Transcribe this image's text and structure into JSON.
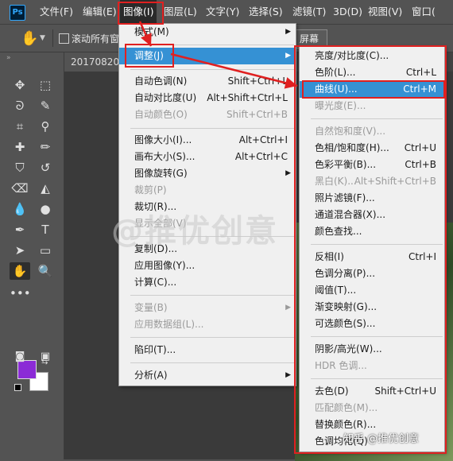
{
  "menubar": {
    "logo": "Ps",
    "items": [
      "文件(F)",
      "编辑(E)",
      "图像(I)",
      "图层(L)",
      "文字(Y)",
      "选择(S)",
      "滤镜(T)",
      "3D(D)",
      "视图(V)",
      "窗口("
    ],
    "active": "图像(I)"
  },
  "optbar": {
    "scroll_all_windows": "滚动所有窗",
    "fill_screen": "屏幕"
  },
  "document": {
    "tab": "20170820_"
  },
  "image_menu": {
    "items": [
      {
        "label": "模式(M)",
        "shortcut": "",
        "submenu": true,
        "disabled": false
      },
      {
        "label": "调整(J)",
        "shortcut": "",
        "submenu": true,
        "disabled": false,
        "highlight": true
      },
      {
        "label": "自动色调(N)",
        "shortcut": "Shift+Ctrl+L",
        "disabled": false
      },
      {
        "label": "自动对比度(U)",
        "shortcut": "Alt+Shift+Ctrl+L",
        "disabled": false
      },
      {
        "label": "自动颜色(O)",
        "shortcut": "Shift+Ctrl+B",
        "disabled": true
      },
      {
        "label": "图像大小(I)...",
        "shortcut": "Alt+Ctrl+I",
        "disabled": false
      },
      {
        "label": "画布大小(S)...",
        "shortcut": "Alt+Ctrl+C",
        "disabled": false
      },
      {
        "label": "图像旋转(G)",
        "shortcut": "",
        "submenu": true,
        "disabled": false
      },
      {
        "label": "裁剪(P)",
        "shortcut": "",
        "disabled": true
      },
      {
        "label": "裁切(R)...",
        "shortcut": "",
        "disabled": false
      },
      {
        "label": "显示全部(V)",
        "shortcut": "",
        "disabled": true
      },
      {
        "label": "复制(D)...",
        "shortcut": "",
        "disabled": false
      },
      {
        "label": "应用图像(Y)...",
        "shortcut": "",
        "disabled": false
      },
      {
        "label": "计算(C)...",
        "shortcut": "",
        "disabled": false
      },
      {
        "label": "变量(B)",
        "shortcut": "",
        "submenu": true,
        "disabled": true
      },
      {
        "label": "应用数据组(L)...",
        "shortcut": "",
        "disabled": true
      },
      {
        "label": "陷印(T)...",
        "shortcut": "",
        "disabled": false
      },
      {
        "label": "分析(A)",
        "shortcut": "",
        "submenu": true,
        "disabled": false
      }
    ]
  },
  "adjust_menu": {
    "items": [
      {
        "label": "亮度/对比度(C)...",
        "shortcut": "",
        "disabled": false
      },
      {
        "label": "色阶(L)...",
        "shortcut": "Ctrl+L",
        "disabled": false
      },
      {
        "label": "曲线(U)...",
        "shortcut": "Ctrl+M",
        "disabled": false,
        "highlight": true
      },
      {
        "label": "曝光度(E)...",
        "shortcut": "",
        "disabled": true
      },
      {
        "label": "自然饱和度(V)...",
        "shortcut": "",
        "disabled": true
      },
      {
        "label": "色相/饱和度(H)...",
        "shortcut": "Ctrl+U",
        "disabled": false
      },
      {
        "label": "色彩平衡(B)...",
        "shortcut": "Ctrl+B",
        "disabled": false
      },
      {
        "label": "黑白(K)...",
        "shortcut": "Alt+Shift+Ctrl+B",
        "disabled": true
      },
      {
        "label": "照片滤镜(F)...",
        "shortcut": "",
        "disabled": false
      },
      {
        "label": "通道混合器(X)...",
        "shortcut": "",
        "disabled": false
      },
      {
        "label": "颜色查找...",
        "shortcut": "",
        "disabled": false
      },
      {
        "label": "反相(I)",
        "shortcut": "Ctrl+I",
        "disabled": false
      },
      {
        "label": "色调分离(P)...",
        "shortcut": "",
        "disabled": false
      },
      {
        "label": "阈值(T)...",
        "shortcut": "",
        "disabled": false
      },
      {
        "label": "渐变映射(G)...",
        "shortcut": "",
        "disabled": false
      },
      {
        "label": "可选颜色(S)...",
        "shortcut": "",
        "disabled": false
      },
      {
        "label": "阴影/高光(W)...",
        "shortcut": "",
        "disabled": false
      },
      {
        "label": "HDR 色调...",
        "shortcut": "",
        "disabled": true
      },
      {
        "label": "去色(D)",
        "shortcut": "Shift+Ctrl+U",
        "disabled": false
      },
      {
        "label": "匹配颜色(M)...",
        "shortcut": "",
        "disabled": true
      },
      {
        "label": "替换颜色(R)...",
        "shortcut": "",
        "disabled": false
      },
      {
        "label": "色调均化(Q)",
        "shortcut": "",
        "disabled": false
      }
    ]
  },
  "colors": {
    "foreground": "#8b2bd6",
    "background": "#ffffff",
    "annotation": "#e02020",
    "highlight": "#3591d4"
  },
  "watermark": "@推优创意",
  "credit": "知乎 @推优创意"
}
